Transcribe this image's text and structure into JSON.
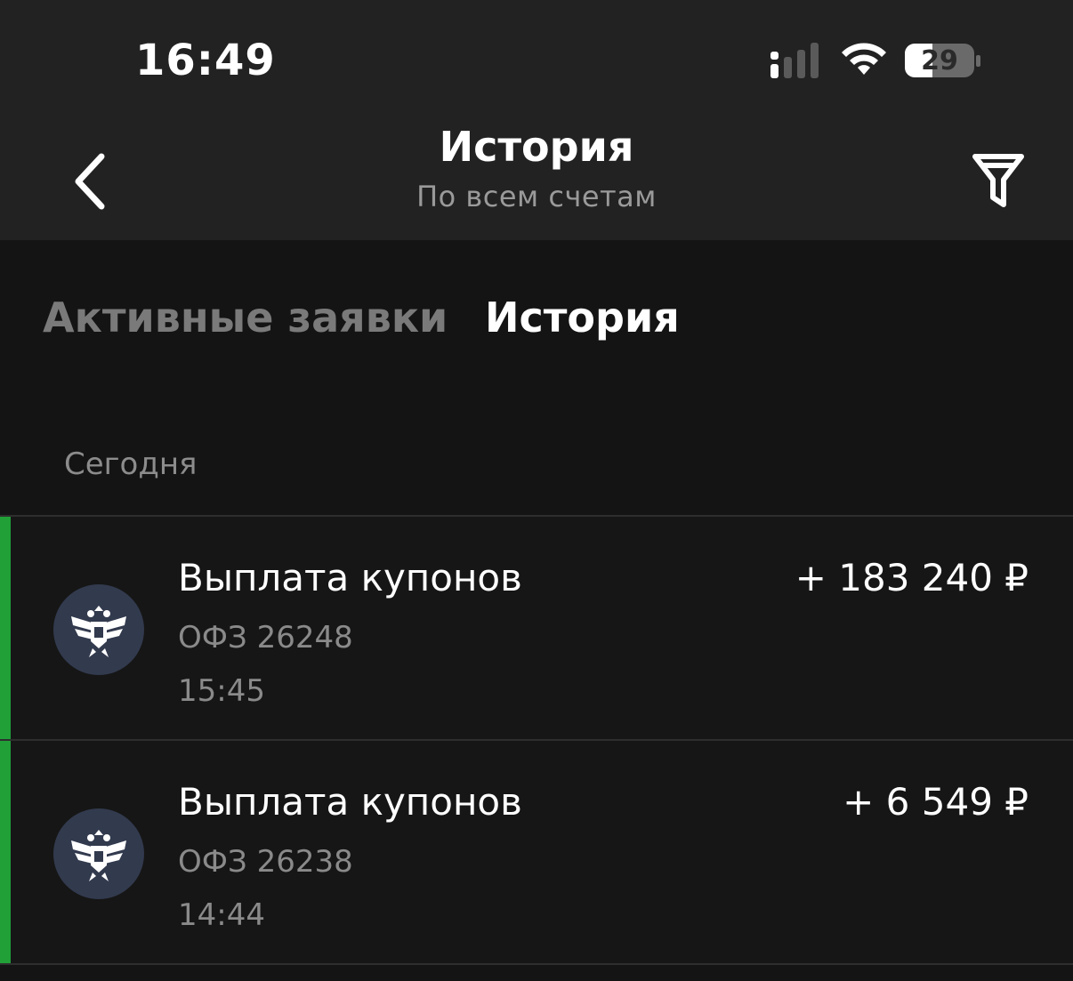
{
  "status_bar": {
    "time": "16:49",
    "battery": "29",
    "icons": [
      "signal-icon",
      "wifi-icon",
      "battery-icon"
    ]
  },
  "nav": {
    "title": "История",
    "subtitle": "По всем счетам",
    "back_icon": "chevron-left-icon",
    "filter_icon": "filter-icon"
  },
  "tabs": [
    {
      "label": "Активные заявки",
      "active": false
    },
    {
      "label": "История",
      "active": true
    }
  ],
  "sections": [
    {
      "label": "Сегодня",
      "transactions": [
        {
          "title": "Выплата купонов",
          "instrument": "ОФЗ 26248",
          "time": "15:45",
          "amount": "+ 183 240 ₽",
          "icon": "coat-of-arms-icon"
        },
        {
          "title": "Выплата купонов",
          "instrument": "ОФЗ 26238",
          "time": "14:44",
          "amount": "+ 6 549 ₽",
          "icon": "coat-of-arms-icon"
        }
      ]
    }
  ],
  "colors": {
    "accent_green": "#21a038",
    "header_bg": "#222222",
    "page_bg": "#141414",
    "muted_text": "#8a8a8a",
    "avatar_bg": "#323a4e"
  }
}
